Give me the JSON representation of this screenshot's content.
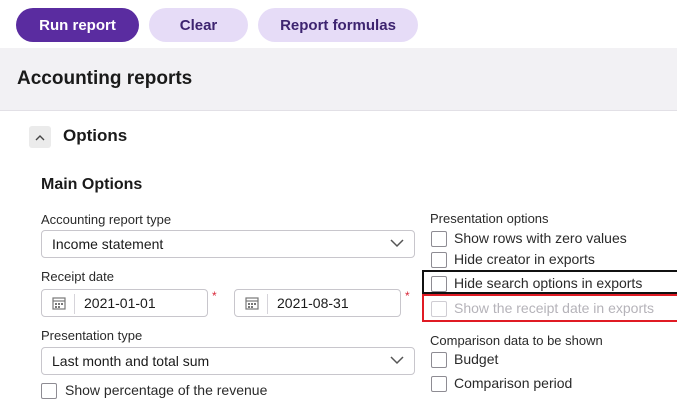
{
  "toolbar": {
    "run_label": "Run report",
    "clear_label": "Clear",
    "formulas_label": "Report formulas"
  },
  "page": {
    "title": "Accounting reports"
  },
  "options": {
    "section_title": "Options",
    "main_title": "Main Options",
    "report_type": {
      "label": "Accounting report type",
      "value": "Income statement"
    },
    "receipt_date": {
      "label": "Receipt date",
      "start": "2021-01-01",
      "end": "2021-08-31",
      "required_mark": "*"
    },
    "presentation_type": {
      "label": "Presentation type",
      "value": "Last month and total sum"
    },
    "show_percentage": {
      "label": "Show percentage of the revenue",
      "checked": false
    }
  },
  "presentation_options": {
    "title": "Presentation options",
    "items": [
      {
        "label": "Show rows with zero values",
        "checked": false,
        "disabled": false
      },
      {
        "label": "Hide creator in exports",
        "checked": false,
        "disabled": false
      },
      {
        "label": "Hide search options in exports",
        "checked": false,
        "disabled": false
      },
      {
        "label": "Show the receipt date in exports",
        "checked": false,
        "disabled": true
      }
    ]
  },
  "comparison": {
    "title": "Comparison data to be shown",
    "items": [
      {
        "label": "Budget",
        "checked": false
      },
      {
        "label": "Comparison period",
        "checked": false
      }
    ]
  },
  "colors": {
    "primary": "#5a2ca0",
    "secondary": "#e6dcf7",
    "highlight_black": "#111111",
    "highlight_red": "#e01b24"
  }
}
